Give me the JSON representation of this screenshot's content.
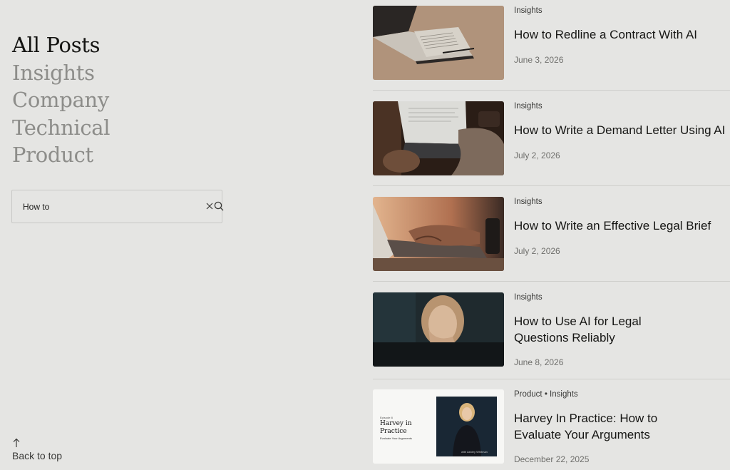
{
  "nav": {
    "items": [
      {
        "label": "All Posts",
        "active": true
      },
      {
        "label": "Insights",
        "active": false
      },
      {
        "label": "Company",
        "active": false
      },
      {
        "label": "Technical",
        "active": false
      },
      {
        "label": "Product",
        "active": false
      }
    ]
  },
  "search": {
    "value": "How to",
    "clear_icon": "close-icon",
    "search_icon": "search-icon"
  },
  "back_to_top": {
    "label": "Back to top",
    "icon": "arrow-up-icon"
  },
  "posts": [
    {
      "category": "Insights",
      "title": "How to Redline a Contract With AI",
      "title_lines": [
        "How to Redline a Contract With AI"
      ],
      "date": "June 3, 2026",
      "image": "laptop-on-table"
    },
    {
      "category": "Insights",
      "title": "How to Write a Demand Letter Using AI",
      "title_lines": [
        "How to Write a Demand Letter Using AI"
      ],
      "date": "July 2, 2026",
      "image": "person-typing-laptop-dark"
    },
    {
      "category": "Insights",
      "title": "How to Write an Effective Legal Brief",
      "title_lines": [
        "How to Write an Effective Legal Brief"
      ],
      "date": "July 2, 2026",
      "image": "hands-on-keyboard"
    },
    {
      "category": "Insights",
      "title": "How to Use AI for Legal Questions Reliably",
      "title_lines": [
        "How to Use AI for Legal",
        "Questions Reliably"
      ],
      "date": "June 8, 2026",
      "image": "woman-at-screen"
    },
    {
      "category": "Product • Insights",
      "title": "Harvey In Practice: How to Evaluate Your Arguments",
      "title_lines": [
        "Harvey In Practice: How to",
        "Evaluate Your Arguments"
      ],
      "date": "December 22, 2025",
      "image": "harvey-in-practice-card",
      "thumb_text": {
        "episode": "Episode 8",
        "headline_1": "Harvey in",
        "headline_2": "Practice",
        "sub": "Evaluate Your Arguments",
        "caption": "with Ashley Whitman"
      }
    }
  ],
  "colors": {
    "background": "#e5e5e3",
    "nav_active": "#141412",
    "nav_inactive": "#8d8d8a"
  }
}
